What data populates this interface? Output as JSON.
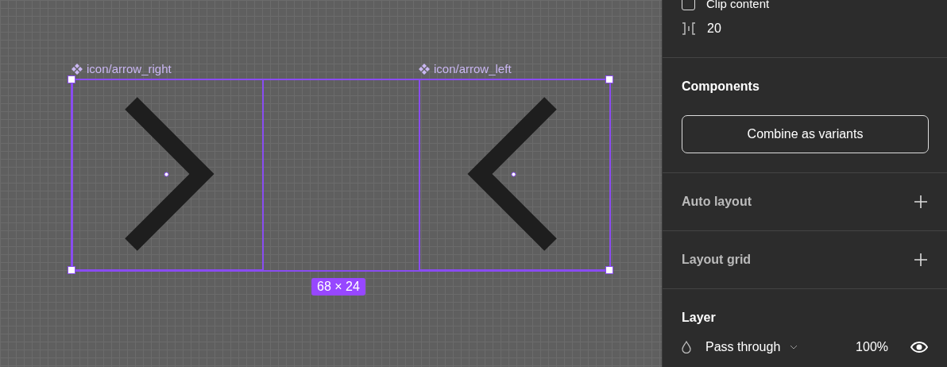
{
  "canvas": {
    "components": [
      {
        "label": "icon/arrow_right",
        "kind": "right"
      },
      {
        "label": "icon/arrow_left",
        "kind": "left"
      }
    ],
    "size_badge": "68 × 24"
  },
  "panel": {
    "clip_content": {
      "label": "Clip content",
      "checked": false
    },
    "spacing": "20",
    "components": {
      "title": "Components",
      "button": "Combine as variants"
    },
    "auto_layout": {
      "title": "Auto layout"
    },
    "layout_grid": {
      "title": "Layout grid"
    },
    "layer": {
      "title": "Layer",
      "blend": "Pass through",
      "opacity": "100%"
    }
  }
}
